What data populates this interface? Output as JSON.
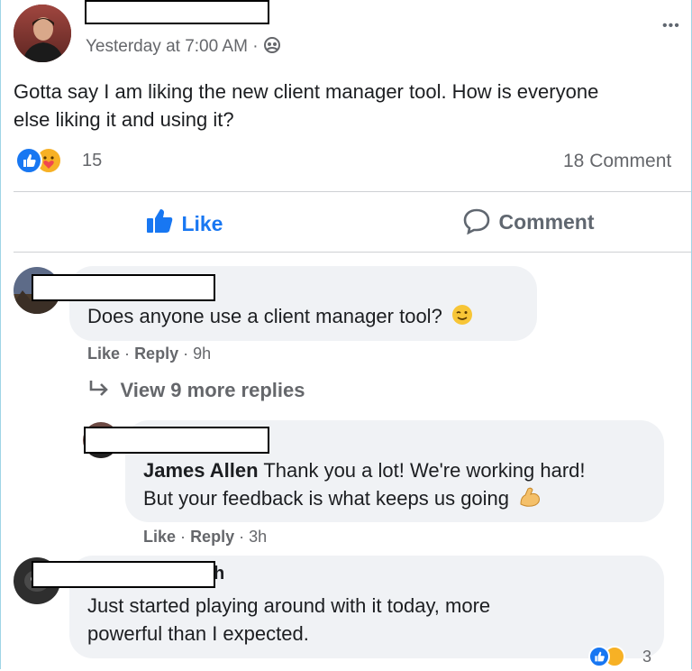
{
  "post": {
    "timestamp": "Yesterday at 7:00 AM",
    "separator": "·",
    "privacy_icon": "friends-icon",
    "more_icon": "more-icon",
    "more_label": "•••",
    "text_line1": "Gotta say I am liking the new client manager tool. How is everyone",
    "text_line2": "else liking it and using it?",
    "reaction_count": "15",
    "comment_count": "18 Comment"
  },
  "action_bar": {
    "like_label": "Like",
    "comment_label": "Comment",
    "like_color": "#1877f2"
  },
  "comments": [
    {
      "text": "Does anyone use a client manager tool?",
      "emoji": "😉",
      "like": "Like",
      "reply": "Reply",
      "time": "9h"
    },
    {
      "view_replies": "View 9 more replies"
    },
    {
      "author": "James Allen",
      "text_line1": "Thank you a lot! We're working hard!",
      "text_line2": "But your feedback is what keeps us going",
      "emoji": "💪",
      "like": "Like",
      "reply": "Reply",
      "time": "3h"
    },
    {
      "name_fragment": "h",
      "text_line1": "Just started playing around with it today, more",
      "text_line2": "powerful than I expected.",
      "reaction_count": "3"
    }
  ],
  "separator_dot": "·"
}
